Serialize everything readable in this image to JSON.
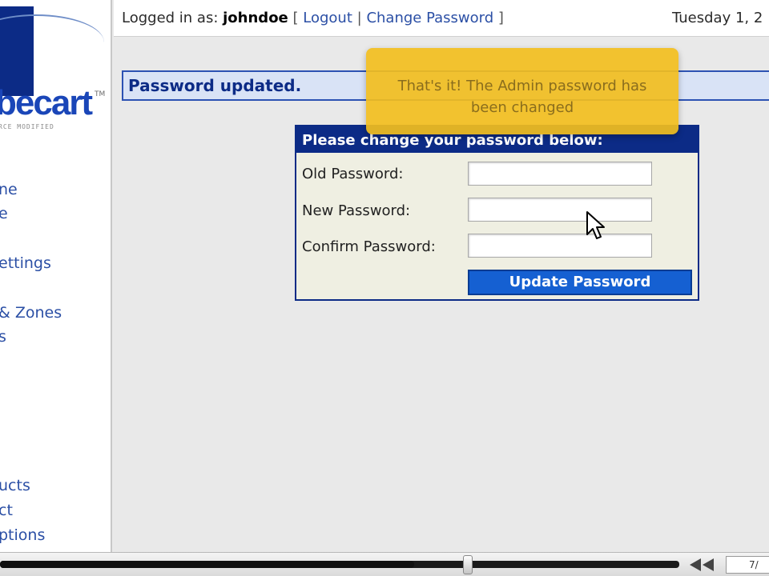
{
  "sidebar": {
    "logo_text": "becart",
    "logo_tm": "TM",
    "logo_tagline": "RCE MODIFIED",
    "nav_items": [
      {
        "label": "ne"
      },
      {
        "label": "e"
      },
      {
        "label": "ettings"
      },
      {
        "label": "& Zones"
      },
      {
        "label": "s"
      },
      {
        "label": "ucts"
      },
      {
        "label": "ct"
      },
      {
        "label": "ptions"
      }
    ]
  },
  "header": {
    "logged_in_prefix": "Logged in as:",
    "username": "johndoe",
    "bracket_open": "[",
    "logout": "Logout",
    "separator": "|",
    "change_password": "Change Password",
    "bracket_close": "]",
    "date": "Tuesday 1, 2"
  },
  "message": {
    "text": "Password updated."
  },
  "tooltip": {
    "text": "That's it!  The Admin password has been changed"
  },
  "form": {
    "title": "Please change your password below:",
    "old_password_label": "Old Password:",
    "new_password_label": "New Password:",
    "confirm_password_label": "Confirm Password:",
    "old_password_value": "",
    "new_password_value": "",
    "confirm_password_value": "",
    "submit_label": "Update Password"
  },
  "player": {
    "progress": 0.61,
    "time_text": "7/"
  },
  "colors": {
    "brand_navy": "#0c2b86",
    "link_blue": "#2b4fa5",
    "message_bg": "#d9e3f6",
    "tooltip_bg": "#f2be1e",
    "button_blue": "#1560d2"
  }
}
